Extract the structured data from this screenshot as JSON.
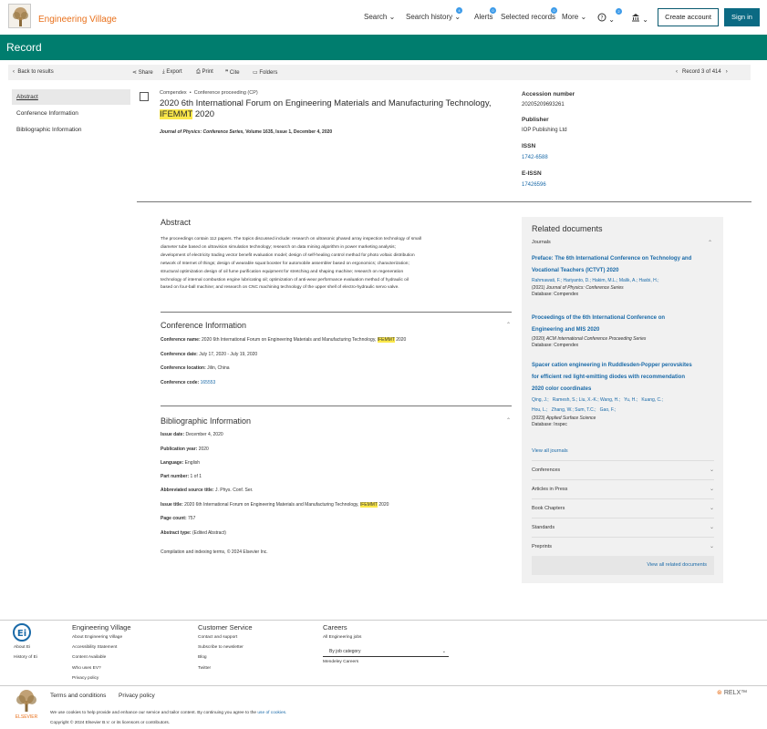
{
  "header": {
    "brand": "Engineering Village",
    "nav": {
      "search": "Search",
      "search_history": "Search history",
      "search_history_count": "4",
      "alerts": "Alerts",
      "alerts_count": "0",
      "selected_records": "Selected records",
      "selected_count": "0",
      "more": "More",
      "help_count": "2"
    },
    "create_account": "Create account",
    "sign_in": "Sign in"
  },
  "band": {
    "title": "Record"
  },
  "toolbar": {
    "back": "Back to results",
    "share": "Share",
    "export": "Export",
    "print": "Print",
    "cite": "Cite",
    "folders": "Folders",
    "position": "Record 3 of 414"
  },
  "left_nav": [
    "Abstract",
    "Conference Information",
    "Bibliographic Information"
  ],
  "record": {
    "database": "Compendex",
    "doc_type": "Conference proceeding (CP)",
    "title_line1": "2020 6th International Forum on Engineering Materials and Manufacturing Technology,",
    "title_hl": "IFEMMT",
    "title_tail": "2020",
    "source": "Journal of Physics: Conference Series,",
    "source_tail": "Volume 1635, Issue 1, December 4, 2020"
  },
  "meta": {
    "accession_label": "Accession number",
    "accession": "20205209693261",
    "publisher_label": "Publisher",
    "publisher": "IOP Publishing Ltd",
    "issn_label": "ISSN",
    "issn": "1742-6588",
    "eissn_label": "E-ISSN",
    "eissn": "17426596"
  },
  "abstract": {
    "heading": "Abstract",
    "lines": [
      "The proceedings contain 112 papers. The topics discussed include: research on ultrasonic phased array inspection technology of small",
      "diameter tube based on ultravision simulation technology; research on data mining algorithm in power marketing analysis;",
      "development of electricity trading vector benefit evaluation model; design of self-healing control method for photo voltaic distribution",
      "network of Internet of things; design of wearable squat booster for automobile assembler based on ergonomics; characterization;",
      "structural optimization design of oil fume purification equipment for stretching and shaping machine; research on regeneration",
      "technology of internal combustion engine lubricating oil; optimization of anti-wear performance evaluation method of hydraulic oil",
      "based on four-ball machine; and research on CNC machining technology of the upper shell of electro-hydraulic servo valve."
    ]
  },
  "conference": {
    "heading": "Conference Information",
    "name_label": "Conference name:",
    "name_value": "2020 6th International Forum on Engineering Materials and Manufacturing Technology,",
    "name_hl": "IFEMMT",
    "name_tail": "2020",
    "date_label": "Conference date:",
    "date_value": "July 17, 2020 - July 19, 2020",
    "location_label": "Conference location:",
    "location_value": "Jilin, China",
    "code_label": "Conference code:",
    "code_value": "165553"
  },
  "bibliographic": {
    "heading": "Bibliographic Information",
    "issue_date_label": "Issue date:",
    "issue_date": "December 4, 2020",
    "pub_year_label": "Publication year:",
    "pub_year": "2020",
    "language_label": "Language:",
    "language": "English",
    "part_label": "Part number:",
    "part": "1 of 1",
    "abbr_label": "Abbreviated source title:",
    "abbr": "J. Phys. Conf. Ser.",
    "issue_title_label": "Issue title:",
    "issue_title": "2020 6th International Forum on Engineering Materials and Manufacturing Technology,",
    "issue_title_hl": "IFEMMT",
    "issue_title_tail": "2020",
    "page_count_label": "Page count:",
    "page_count": "757",
    "abstract_type_label": "Abstract type:",
    "abstract_type": "(Edited Abstract)",
    "compilation": "Compilation and indexing terms, © 2024 Elsevier Inc."
  },
  "related": {
    "heading": "Related documents",
    "journals_label": "Journals",
    "items": [
      {
        "title1": "Preface: The 6th International Conference on Technology and",
        "title2": "Vocational Teachers (ICTVT) 2020",
        "authors": "Rahmawati, F.; Hariyanto, D.; Hakim, M.L.; Malik, A.; Hasbi, H.;",
        "year": "(2021)",
        "journal": "Journal of Physics: Conference Series",
        "database": "Database: Compendex"
      },
      {
        "title1": "Proceedings of the 6th International Conference on",
        "title2": "Engineering and MIS 2020",
        "year": "(2020)",
        "journal": "ACM International Conference Proceeding Series",
        "database": "Database: Compendex"
      },
      {
        "title1": "Spacer cation engineering in Ruddlesden-Popper perovskites",
        "title2": "for efficient red light-emitting diodes with recommendation",
        "title3": "2020 color coordinates",
        "authors1": "Qing, J.;   Ramesh, S.; Liu, X.-K.; Wang, H.;   Yu, H.;   Kuang, C.;",
        "authors2": "Hou, L.;   Zhang, W.; Sum, T.C.;   Gao, F.;",
        "year": "(2023)",
        "journal": "Applied Surface Science",
        "database": "Database: Inspec"
      }
    ],
    "view_all_journals": "View all journals",
    "rows": [
      "Conferences",
      "Articles in Press",
      "Book Chapters",
      "Standards",
      "Preprints"
    ],
    "view_all_related": "View all related documents"
  },
  "footer": {
    "about": "About Ei",
    "history": "History of Ei",
    "col1_heading": "Engineering Village",
    "col1": [
      "About Engineering Village",
      "Accessibility Statement",
      "Content Available",
      "Who uses EV?",
      "Privacy policy"
    ],
    "col2_heading": "Customer Service",
    "col2": [
      "Contact and support",
      "Subscribe to newsletter",
      "Blog",
      "Twitter"
    ],
    "col3_heading": "Careers",
    "col3_link": "All Engineering jobs",
    "select_value": "By job category",
    "mendeley": "Mendeley Careers",
    "terms": "Terms and conditions",
    "privacy": "Privacy policy",
    "cookie_text": "We use cookies to help provide and enhance our service and tailor content. By continuing you agree to the",
    "cookie_link": "use of cookies.",
    "copyright": "Copyright © 2024 Elsevier B.V. or its licensors or contributors.",
    "relx": "RELX™",
    "elsevier": "ELSEVIER"
  },
  "colors": {
    "band": "#007d6e",
    "brand": "#e9711c",
    "link": "#1a6aa8",
    "highlight": "#fbe84a"
  }
}
